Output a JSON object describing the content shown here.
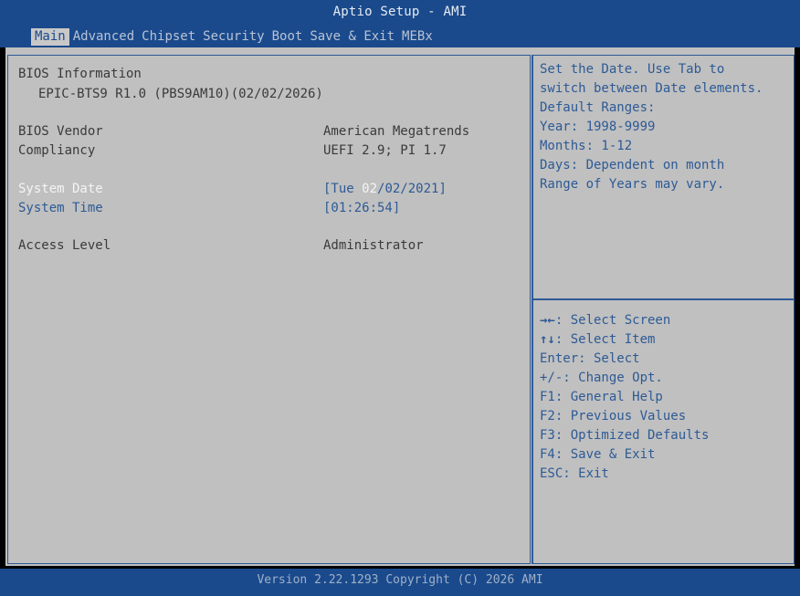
{
  "title": "Aptio Setup - AMI",
  "menu": [
    {
      "label": "Main",
      "active": true
    },
    {
      "label": "Advanced",
      "active": false
    },
    {
      "label": "Chipset",
      "active": false
    },
    {
      "label": "Security",
      "active": false
    },
    {
      "label": "Boot",
      "active": false
    },
    {
      "label": "Save & Exit",
      "active": false
    },
    {
      "label": "MEBx",
      "active": false
    }
  ],
  "bios_info": {
    "heading": "BIOS Information",
    "version": "EPIC-BTS9 R1.0 (PBS9AM10)(02/02/2026)",
    "vendor_label": "BIOS Vendor",
    "vendor_value": "American Megatrends",
    "compliancy_label": "Compliancy",
    "compliancy_value": "UEFI 2.9; PI 1.7"
  },
  "system": {
    "date_label": "System Date",
    "date_prefix": "[Tue ",
    "date_selected": "02",
    "date_suffix": "/02/2021]",
    "time_label": "System Time",
    "time_value": "[01:26:54]",
    "access_label": "Access Level",
    "access_value": "Administrator"
  },
  "help_text": [
    "Set the Date. Use Tab to",
    "switch between Date elements.",
    "Default Ranges:",
    "Year: 1998-9999",
    "Months: 1-12",
    "Days: Dependent on month",
    "Range of Years may vary."
  ],
  "keys": [
    {
      "key": "→←",
      "desc": ": Select Screen"
    },
    {
      "key": "↑↓",
      "desc": ": Select Item"
    },
    {
      "key": "",
      "desc": "Enter: Select"
    },
    {
      "key": "",
      "desc": "+/-: Change Opt."
    },
    {
      "key": "",
      "desc": "F1: General Help"
    },
    {
      "key": "",
      "desc": "F2: Previous Values"
    },
    {
      "key": "",
      "desc": "F3: Optimized Defaults"
    },
    {
      "key": "",
      "desc": "F4: Save & Exit"
    },
    {
      "key": "",
      "desc": "ESC: Exit"
    }
  ],
  "footer": "Version 2.22.1293 Copyright (C) 2026 AMI",
  "colors": {
    "bar": "#1a4a8c",
    "panel": "#c0c0c0",
    "label_text": "#3a3a3a",
    "selected_text": "#f4f4f4",
    "value_blue": "#2d5a96"
  }
}
